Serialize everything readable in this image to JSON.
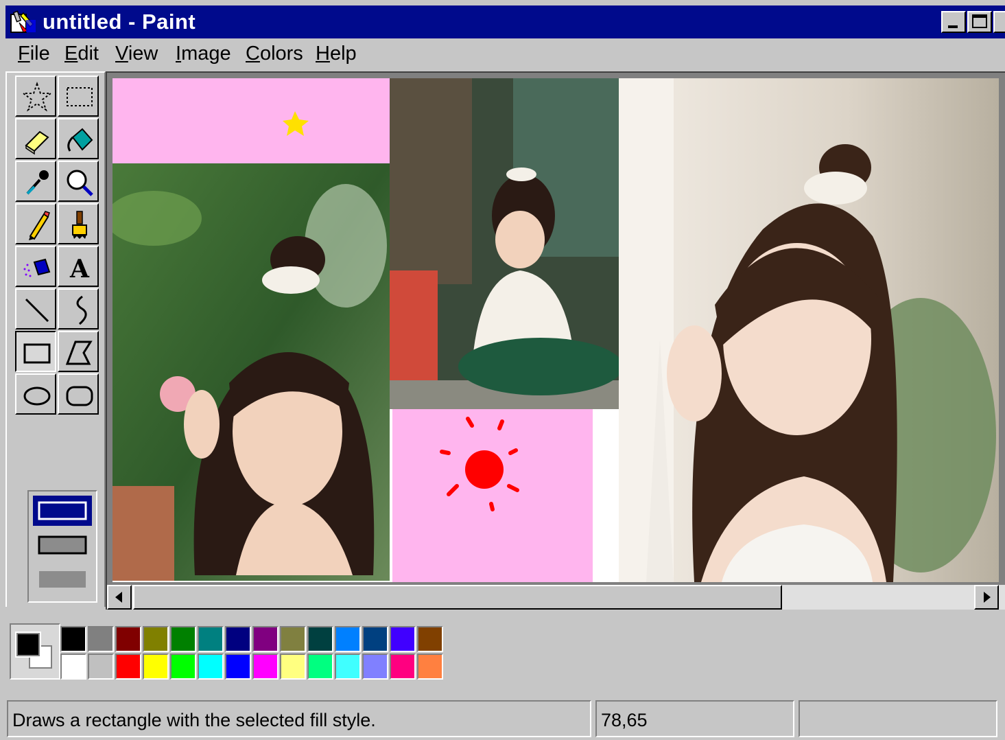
{
  "window": {
    "title": "untitled - Paint"
  },
  "menu": {
    "items": [
      {
        "label": "File",
        "accel": "F",
        "rest": "ile"
      },
      {
        "label": "Edit",
        "accel": "E",
        "rest": "dit"
      },
      {
        "label": "View",
        "accel": "V",
        "rest": "iew"
      },
      {
        "label": "Image",
        "accel": "I",
        "rest": "mage"
      },
      {
        "label": "Colors",
        "accel": "C",
        "rest": "olors"
      },
      {
        "label": "Help",
        "accel": "H",
        "rest": "elp"
      }
    ]
  },
  "tools": [
    "free-form-select",
    "rectangle-select",
    "eraser",
    "fill-with-color",
    "pick-color",
    "magnifier",
    "pencil",
    "brush",
    "airbrush",
    "text",
    "line",
    "curve",
    "rectangle",
    "polygon",
    "ellipse",
    "rounded-rectangle"
  ],
  "selected_tool": "rectangle",
  "fill_styles": [
    "outline",
    "outline-and-fill",
    "fill-only"
  ],
  "selected_fill_style": "outline",
  "palette": {
    "foreground": "#000000",
    "background": "#ffffff",
    "row1": [
      "#000000",
      "#808080",
      "#800000",
      "#808000",
      "#008000",
      "#008080",
      "#000080",
      "#800080",
      "#808040",
      "#004040",
      "#0080ff",
      "#004080",
      "#4000ff",
      "#804000"
    ],
    "row2": [
      "#ffffff",
      "#c0c0c0",
      "#ff0000",
      "#ffff00",
      "#00ff00",
      "#00ffff",
      "#0000ff",
      "#ff00ff",
      "#ffff80",
      "#00ff80",
      "#40ffff",
      "#8080ff",
      "#ff0080",
      "#ff8040"
    ]
  },
  "canvas": {
    "pink": "#ffb5ee",
    "star_color": "#ffe000",
    "sun_color": "#ff0000"
  },
  "status": {
    "message": "Draws a rectangle with the selected fill style.",
    "coordinates": "78,65",
    "extra": ""
  }
}
